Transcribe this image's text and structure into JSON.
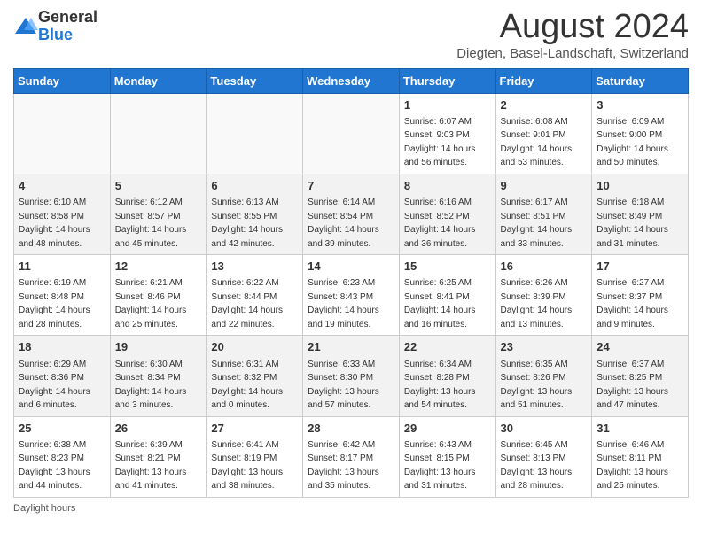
{
  "header": {
    "logo_general": "General",
    "logo_blue": "Blue",
    "title": "August 2024",
    "subtitle": "Diegten, Basel-Landschaft, Switzerland"
  },
  "days_of_week": [
    "Sunday",
    "Monday",
    "Tuesday",
    "Wednesday",
    "Thursday",
    "Friday",
    "Saturday"
  ],
  "weeks": [
    [
      {
        "day": "",
        "info": ""
      },
      {
        "day": "",
        "info": ""
      },
      {
        "day": "",
        "info": ""
      },
      {
        "day": "",
        "info": ""
      },
      {
        "day": "1",
        "info": "Sunrise: 6:07 AM\nSunset: 9:03 PM\nDaylight: 14 hours\nand 56 minutes."
      },
      {
        "day": "2",
        "info": "Sunrise: 6:08 AM\nSunset: 9:01 PM\nDaylight: 14 hours\nand 53 minutes."
      },
      {
        "day": "3",
        "info": "Sunrise: 6:09 AM\nSunset: 9:00 PM\nDaylight: 14 hours\nand 50 minutes."
      }
    ],
    [
      {
        "day": "4",
        "info": "Sunrise: 6:10 AM\nSunset: 8:58 PM\nDaylight: 14 hours\nand 48 minutes."
      },
      {
        "day": "5",
        "info": "Sunrise: 6:12 AM\nSunset: 8:57 PM\nDaylight: 14 hours\nand 45 minutes."
      },
      {
        "day": "6",
        "info": "Sunrise: 6:13 AM\nSunset: 8:55 PM\nDaylight: 14 hours\nand 42 minutes."
      },
      {
        "day": "7",
        "info": "Sunrise: 6:14 AM\nSunset: 8:54 PM\nDaylight: 14 hours\nand 39 minutes."
      },
      {
        "day": "8",
        "info": "Sunrise: 6:16 AM\nSunset: 8:52 PM\nDaylight: 14 hours\nand 36 minutes."
      },
      {
        "day": "9",
        "info": "Sunrise: 6:17 AM\nSunset: 8:51 PM\nDaylight: 14 hours\nand 33 minutes."
      },
      {
        "day": "10",
        "info": "Sunrise: 6:18 AM\nSunset: 8:49 PM\nDaylight: 14 hours\nand 31 minutes."
      }
    ],
    [
      {
        "day": "11",
        "info": "Sunrise: 6:19 AM\nSunset: 8:48 PM\nDaylight: 14 hours\nand 28 minutes."
      },
      {
        "day": "12",
        "info": "Sunrise: 6:21 AM\nSunset: 8:46 PM\nDaylight: 14 hours\nand 25 minutes."
      },
      {
        "day": "13",
        "info": "Sunrise: 6:22 AM\nSunset: 8:44 PM\nDaylight: 14 hours\nand 22 minutes."
      },
      {
        "day": "14",
        "info": "Sunrise: 6:23 AM\nSunset: 8:43 PM\nDaylight: 14 hours\nand 19 minutes."
      },
      {
        "day": "15",
        "info": "Sunrise: 6:25 AM\nSunset: 8:41 PM\nDaylight: 14 hours\nand 16 minutes."
      },
      {
        "day": "16",
        "info": "Sunrise: 6:26 AM\nSunset: 8:39 PM\nDaylight: 14 hours\nand 13 minutes."
      },
      {
        "day": "17",
        "info": "Sunrise: 6:27 AM\nSunset: 8:37 PM\nDaylight: 14 hours\nand 9 minutes."
      }
    ],
    [
      {
        "day": "18",
        "info": "Sunrise: 6:29 AM\nSunset: 8:36 PM\nDaylight: 14 hours\nand 6 minutes."
      },
      {
        "day": "19",
        "info": "Sunrise: 6:30 AM\nSunset: 8:34 PM\nDaylight: 14 hours\nand 3 minutes."
      },
      {
        "day": "20",
        "info": "Sunrise: 6:31 AM\nSunset: 8:32 PM\nDaylight: 14 hours and 0 minutes."
      },
      {
        "day": "21",
        "info": "Sunrise: 6:33 AM\nSunset: 8:30 PM\nDaylight: 13 hours\nand 57 minutes."
      },
      {
        "day": "22",
        "info": "Sunrise: 6:34 AM\nSunset: 8:28 PM\nDaylight: 13 hours\nand 54 minutes."
      },
      {
        "day": "23",
        "info": "Sunrise: 6:35 AM\nSunset: 8:26 PM\nDaylight: 13 hours\nand 51 minutes."
      },
      {
        "day": "24",
        "info": "Sunrise: 6:37 AM\nSunset: 8:25 PM\nDaylight: 13 hours\nand 47 minutes."
      }
    ],
    [
      {
        "day": "25",
        "info": "Sunrise: 6:38 AM\nSunset: 8:23 PM\nDaylight: 13 hours\nand 44 minutes."
      },
      {
        "day": "26",
        "info": "Sunrise: 6:39 AM\nSunset: 8:21 PM\nDaylight: 13 hours\nand 41 minutes."
      },
      {
        "day": "27",
        "info": "Sunrise: 6:41 AM\nSunset: 8:19 PM\nDaylight: 13 hours\nand 38 minutes."
      },
      {
        "day": "28",
        "info": "Sunrise: 6:42 AM\nSunset: 8:17 PM\nDaylight: 13 hours\nand 35 minutes."
      },
      {
        "day": "29",
        "info": "Sunrise: 6:43 AM\nSunset: 8:15 PM\nDaylight: 13 hours\nand 31 minutes."
      },
      {
        "day": "30",
        "info": "Sunrise: 6:45 AM\nSunset: 8:13 PM\nDaylight: 13 hours\nand 28 minutes."
      },
      {
        "day": "31",
        "info": "Sunrise: 6:46 AM\nSunset: 8:11 PM\nDaylight: 13 hours\nand 25 minutes."
      }
    ]
  ],
  "footer": {
    "note": "Daylight hours"
  }
}
